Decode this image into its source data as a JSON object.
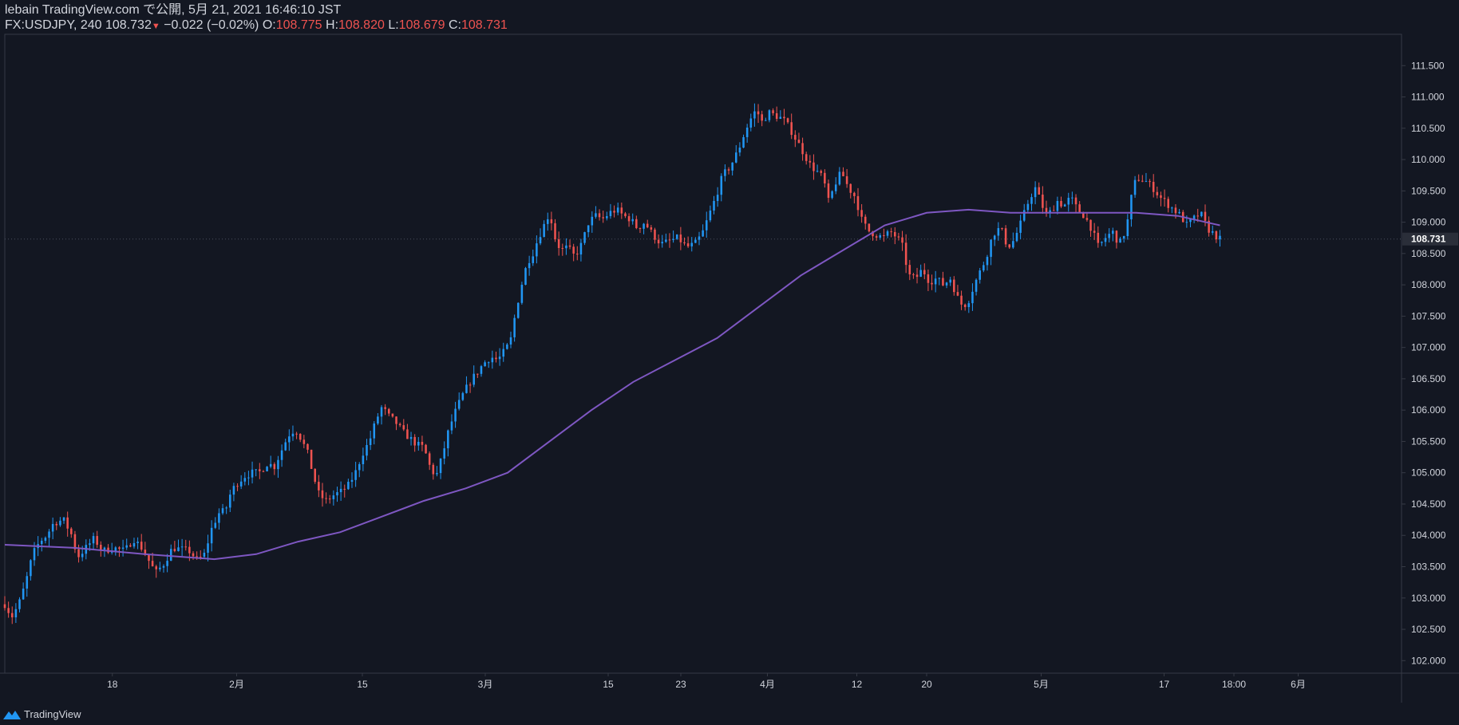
{
  "header": {
    "publish_line": "lebain TradingView.com で公開, 5月 21, 2021 16:46:10 JST",
    "symbol": "FX:USDJPY",
    "interval": "240",
    "last": "108.732",
    "change_arrow": "▼",
    "change": "−0.022 (−0.02%)",
    "o_label": "O:",
    "o_value": "108.775",
    "h_label": "H:",
    "h_value": "108.820",
    "l_label": "L:",
    "l_value": "108.679",
    "c_label": "C:",
    "c_value": "108.731"
  },
  "footer": {
    "brand": "TradingView",
    "icon": "tradingview-logo-icon"
  },
  "colors": {
    "background": "#131722",
    "up": "#2196f3",
    "down": "#ef5350",
    "ma": "#7e57c2",
    "text": "#d1d4dc",
    "border": "#363a45"
  },
  "chart_data": {
    "type": "candlestick",
    "symbol": "FX:USDJPY",
    "interval": "240",
    "y_axis": {
      "min": 101.8,
      "max": 112.0,
      "ticks": [
        "102.000",
        "102.500",
        "103.000",
        "103.500",
        "104.000",
        "104.500",
        "105.000",
        "105.500",
        "106.000",
        "106.500",
        "107.000",
        "107.500",
        "108.000",
        "108.500",
        "109.000",
        "109.500",
        "110.000",
        "110.500",
        "111.000",
        "111.500"
      ]
    },
    "x_labels": [
      {
        "label": "18",
        "t": 0.077
      },
      {
        "label": "2月",
        "t": 0.166
      },
      {
        "label": "15",
        "t": 0.256
      },
      {
        "label": "3月",
        "t": 0.344
      },
      {
        "label": "15",
        "t": 0.432
      },
      {
        "label": "23",
        "t": 0.484
      },
      {
        "label": "4月",
        "t": 0.546
      },
      {
        "label": "12",
        "t": 0.61
      },
      {
        "label": "20",
        "t": 0.66
      },
      {
        "label": "5月",
        "t": 0.742
      },
      {
        "label": "17",
        "t": 0.83
      },
      {
        "label": "18:00",
        "t": 0.88
      },
      {
        "label": "6月",
        "t": 0.926
      }
    ],
    "last_price_label": "108.731",
    "last_price": 108.731,
    "price_path": [
      [
        0.0,
        102.9
      ],
      [
        0.005,
        102.7
      ],
      [
        0.01,
        102.9
      ],
      [
        0.015,
        103.25
      ],
      [
        0.02,
        103.7
      ],
      [
        0.025,
        103.9
      ],
      [
        0.03,
        104.0
      ],
      [
        0.035,
        104.2
      ],
      [
        0.042,
        104.25
      ],
      [
        0.048,
        104.0
      ],
      [
        0.052,
        103.65
      ],
      [
        0.058,
        103.8
      ],
      [
        0.064,
        103.95
      ],
      [
        0.07,
        103.75
      ],
      [
        0.078,
        103.8
      ],
      [
        0.086,
        103.75
      ],
      [
        0.092,
        103.95
      ],
      [
        0.098,
        103.8
      ],
      [
        0.103,
        103.6
      ],
      [
        0.108,
        103.4
      ],
      [
        0.114,
        103.55
      ],
      [
        0.12,
        103.8
      ],
      [
        0.126,
        103.78
      ],
      [
        0.132,
        103.75
      ],
      [
        0.138,
        103.6
      ],
      [
        0.143,
        103.7
      ],
      [
        0.148,
        104.1
      ],
      [
        0.153,
        104.35
      ],
      [
        0.158,
        104.4
      ],
      [
        0.162,
        104.7
      ],
      [
        0.167,
        104.85
      ],
      [
        0.172,
        104.95
      ],
      [
        0.177,
        105.0
      ],
      [
        0.182,
        105.0
      ],
      [
        0.188,
        105.15
      ],
      [
        0.193,
        105.1
      ],
      [
        0.198,
        105.35
      ],
      [
        0.203,
        105.6
      ],
      [
        0.208,
        105.7
      ],
      [
        0.212,
        105.55
      ],
      [
        0.217,
        105.3
      ],
      [
        0.221,
        104.95
      ],
      [
        0.225,
        104.65
      ],
      [
        0.23,
        104.55
      ],
      [
        0.236,
        104.65
      ],
      [
        0.241,
        104.7
      ],
      [
        0.246,
        104.8
      ],
      [
        0.251,
        105.0
      ],
      [
        0.256,
        105.3
      ],
      [
        0.261,
        105.5
      ],
      [
        0.266,
        105.85
      ],
      [
        0.27,
        106.05
      ],
      [
        0.275,
        105.9
      ],
      [
        0.28,
        105.8
      ],
      [
        0.285,
        105.65
      ],
      [
        0.29,
        105.55
      ],
      [
        0.295,
        105.45
      ],
      [
        0.3,
        105.4
      ],
      [
        0.305,
        105.05
      ],
      [
        0.309,
        104.95
      ],
      [
        0.313,
        105.25
      ],
      [
        0.318,
        105.7
      ],
      [
        0.323,
        106.0
      ],
      [
        0.328,
        106.25
      ],
      [
        0.333,
        106.45
      ],
      [
        0.338,
        106.6
      ],
      [
        0.343,
        106.75
      ],
      [
        0.348,
        106.85
      ],
      [
        0.353,
        106.8
      ],
      [
        0.358,
        106.95
      ],
      [
        0.362,
        107.1
      ],
      [
        0.366,
        107.6
      ],
      [
        0.37,
        108.0
      ],
      [
        0.374,
        108.35
      ],
      [
        0.378,
        108.5
      ],
      [
        0.382,
        108.75
      ],
      [
        0.386,
        108.95
      ],
      [
        0.39,
        109.15
      ],
      [
        0.394,
        108.75
      ],
      [
        0.398,
        108.55
      ],
      [
        0.403,
        108.6
      ],
      [
        0.408,
        108.45
      ],
      [
        0.413,
        108.65
      ],
      [
        0.418,
        109.0
      ],
      [
        0.423,
        109.1
      ],
      [
        0.428,
        109.05
      ],
      [
        0.433,
        109.15
      ],
      [
        0.438,
        109.2
      ],
      [
        0.443,
        109.1
      ],
      [
        0.448,
        109.05
      ],
      [
        0.453,
        108.9
      ],
      [
        0.458,
        109.0
      ],
      [
        0.464,
        108.8
      ],
      [
        0.47,
        108.65
      ],
      [
        0.476,
        108.7
      ],
      [
        0.482,
        108.75
      ],
      [
        0.488,
        108.6
      ],
      [
        0.494,
        108.65
      ],
      [
        0.499,
        108.8
      ],
      [
        0.504,
        109.1
      ],
      [
        0.509,
        109.4
      ],
      [
        0.514,
        109.75
      ],
      [
        0.518,
        109.85
      ],
      [
        0.522,
        110.0
      ],
      [
        0.526,
        110.2
      ],
      [
        0.53,
        110.45
      ],
      [
        0.534,
        110.65
      ],
      [
        0.538,
        110.8
      ],
      [
        0.542,
        110.6
      ],
      [
        0.547,
        110.75
      ],
      [
        0.552,
        110.7
      ],
      [
        0.557,
        110.65
      ],
      [
        0.562,
        110.5
      ],
      [
        0.567,
        110.3
      ],
      [
        0.572,
        110.1
      ],
      [
        0.577,
        109.9
      ],
      [
        0.582,
        109.8
      ],
      [
        0.586,
        109.7
      ],
      [
        0.59,
        109.3
      ],
      [
        0.594,
        109.6
      ],
      [
        0.599,
        109.8
      ],
      [
        0.604,
        109.55
      ],
      [
        0.609,
        109.4
      ],
      [
        0.614,
        109.0
      ],
      [
        0.619,
        108.85
      ],
      [
        0.624,
        108.8
      ],
      [
        0.629,
        108.75
      ],
      [
        0.634,
        108.85
      ],
      [
        0.639,
        108.75
      ],
      [
        0.643,
        108.6
      ],
      [
        0.647,
        108.15
      ],
      [
        0.652,
        108.1
      ],
      [
        0.657,
        108.25
      ],
      [
        0.662,
        108.05
      ],
      [
        0.667,
        108.1
      ],
      [
        0.672,
        108.0
      ],
      [
        0.677,
        108.1
      ],
      [
        0.682,
        107.8
      ],
      [
        0.686,
        107.65
      ],
      [
        0.69,
        107.75
      ],
      [
        0.694,
        108.0
      ],
      [
        0.698,
        108.2
      ],
      [
        0.702,
        108.4
      ],
      [
        0.706,
        108.7
      ],
      [
        0.71,
        108.9
      ],
      [
        0.714,
        108.85
      ],
      [
        0.718,
        108.6
      ],
      [
        0.722,
        108.7
      ],
      [
        0.726,
        108.9
      ],
      [
        0.73,
        109.15
      ],
      [
        0.734,
        109.4
      ],
      [
        0.738,
        109.55
      ],
      [
        0.742,
        109.3
      ],
      [
        0.746,
        109.1
      ],
      [
        0.75,
        109.2
      ],
      [
        0.754,
        109.35
      ],
      [
        0.758,
        109.25
      ],
      [
        0.763,
        109.4
      ],
      [
        0.768,
        109.2
      ],
      [
        0.773,
        109.1
      ],
      [
        0.778,
        108.9
      ],
      [
        0.783,
        108.6
      ],
      [
        0.788,
        108.75
      ],
      [
        0.793,
        108.85
      ],
      [
        0.798,
        108.65
      ],
      [
        0.803,
        108.9
      ],
      [
        0.808,
        109.6
      ],
      [
        0.812,
        109.7
      ],
      [
        0.817,
        109.65
      ],
      [
        0.822,
        109.55
      ],
      [
        0.827,
        109.4
      ],
      [
        0.832,
        109.3
      ],
      [
        0.837,
        109.2
      ],
      [
        0.842,
        109.1
      ],
      [
        0.846,
        108.95
      ],
      [
        0.851,
        109.05
      ],
      [
        0.856,
        109.15
      ],
      [
        0.861,
        108.9
      ],
      [
        0.866,
        108.8
      ],
      [
        0.87,
        108.73
      ]
    ],
    "ma_path": [
      [
        0.0,
        103.85
      ],
      [
        0.05,
        103.8
      ],
      [
        0.1,
        103.7
      ],
      [
        0.15,
        103.62
      ],
      [
        0.18,
        103.7
      ],
      [
        0.21,
        103.9
      ],
      [
        0.24,
        104.05
      ],
      [
        0.27,
        104.3
      ],
      [
        0.3,
        104.55
      ],
      [
        0.33,
        104.75
      ],
      [
        0.36,
        105.0
      ],
      [
        0.39,
        105.5
      ],
      [
        0.42,
        106.0
      ],
      [
        0.45,
        106.45
      ],
      [
        0.48,
        106.8
      ],
      [
        0.51,
        107.15
      ],
      [
        0.54,
        107.65
      ],
      [
        0.57,
        108.15
      ],
      [
        0.6,
        108.55
      ],
      [
        0.63,
        108.95
      ],
      [
        0.66,
        109.15
      ],
      [
        0.69,
        109.2
      ],
      [
        0.72,
        109.15
      ],
      [
        0.75,
        109.15
      ],
      [
        0.78,
        109.15
      ],
      [
        0.81,
        109.15
      ],
      [
        0.84,
        109.1
      ],
      [
        0.87,
        108.95
      ]
    ]
  }
}
